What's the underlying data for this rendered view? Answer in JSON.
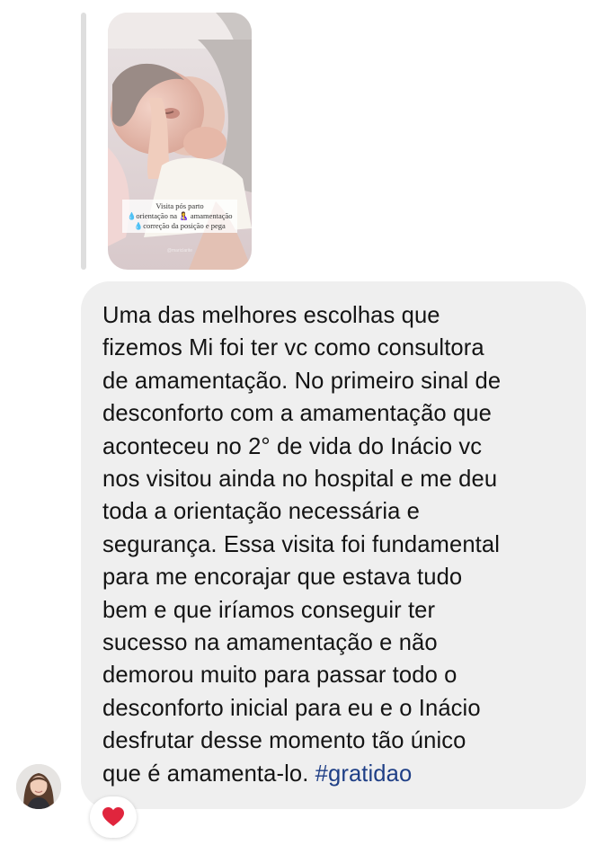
{
  "story_reply": {
    "caption_lines": [
      "Visita  pós parto",
      "orientação na",
      "amamentação",
      "correção da posição e pega"
    ],
    "watermark": "@mariclarite"
  },
  "message": {
    "lines": [
      "Uma das melhores escolhas que",
      "fizemos Mi foi ter vc como consultora",
      "de amamentação. No primeiro sinal de",
      "desconforto com a amamentação que",
      "aconteceu no 2° de vida do Inácio vc",
      "nos visitou ainda no hospital e me deu",
      "toda a orientação necessária e",
      "segurança. Essa visita foi fundamental",
      "para me encorajar que estava tudo",
      "bem e que iríamos conseguir ter",
      "sucesso na amamentação e não",
      "demorou muito para passar todo o",
      "desconforto inicial para eu e o Inácio",
      "desfrutar desse momento tão único",
      "que é amamenta-lo."
    ],
    "hashtag": "#gratidao"
  },
  "reaction": {
    "icon": "heart-icon",
    "color": "#e0253d"
  },
  "colors": {
    "bubble": "#efefef",
    "hashtag": "#1f3f86",
    "reply_bar": "#dedede"
  }
}
